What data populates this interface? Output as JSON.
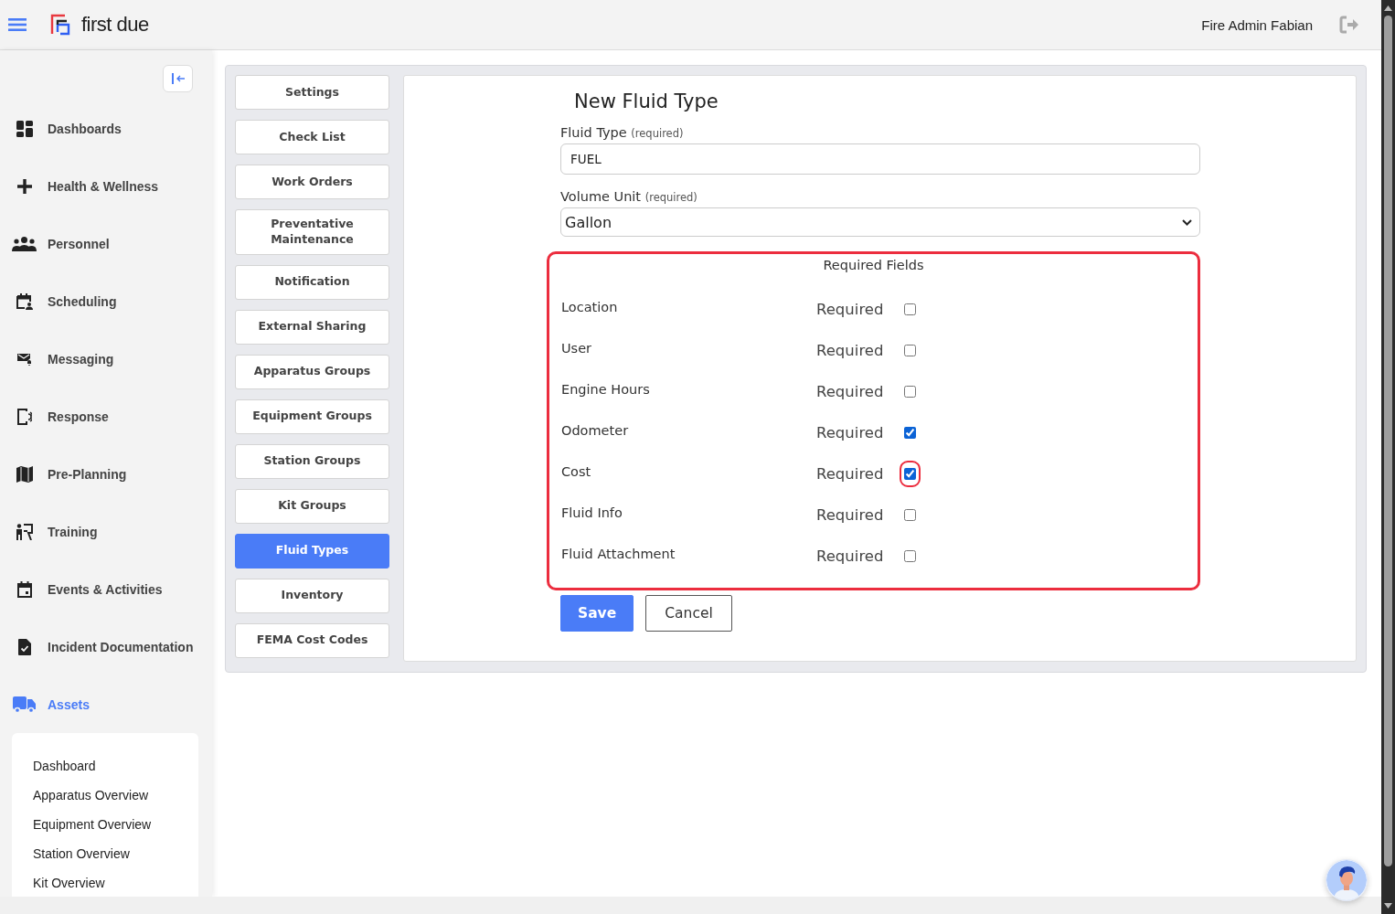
{
  "logo": {
    "text": "first due"
  },
  "header": {
    "user_name": "Fire Admin Fabian"
  },
  "sidebar": {
    "items": [
      {
        "label": "Dashboards",
        "selected": false
      },
      {
        "label": "Health & Wellness",
        "selected": false
      },
      {
        "label": "Personnel",
        "selected": false
      },
      {
        "label": "Scheduling",
        "selected": false
      },
      {
        "label": "Messaging",
        "selected": false
      },
      {
        "label": "Response",
        "selected": false
      },
      {
        "label": "Pre-Planning",
        "selected": false
      },
      {
        "label": "Training",
        "selected": false
      },
      {
        "label": "Events & Activities",
        "selected": false
      },
      {
        "label": "Incident Documentation",
        "selected": false
      },
      {
        "label": "Assets",
        "selected": true,
        "children": [
          {
            "label": "Dashboard"
          },
          {
            "label": "Apparatus Overview"
          },
          {
            "label": "Equipment Overview"
          },
          {
            "label": "Station Overview"
          },
          {
            "label": "Kit Overview"
          }
        ]
      }
    ]
  },
  "settings_menu": [
    {
      "label": "Settings",
      "selected": false
    },
    {
      "label": "Check List",
      "selected": false
    },
    {
      "label": "Work Orders",
      "selected": false
    },
    {
      "label": "Preventative Maintenance",
      "selected": false
    },
    {
      "label": "Notification",
      "selected": false
    },
    {
      "label": "External Sharing",
      "selected": false
    },
    {
      "label": "Apparatus Groups",
      "selected": false
    },
    {
      "label": "Equipment Groups",
      "selected": false
    },
    {
      "label": "Station Groups",
      "selected": false
    },
    {
      "label": "Kit Groups",
      "selected": false
    },
    {
      "label": "Fluid Types",
      "selected": true
    },
    {
      "label": "Inventory",
      "selected": false
    },
    {
      "label": "FEMA Cost Codes",
      "selected": false
    }
  ],
  "form": {
    "title": "New Fluid Type",
    "fields": [
      {
        "label": "Fluid Type",
        "note": "(required)",
        "kind": "text",
        "value": "FUEL"
      },
      {
        "label": "Volume Unit",
        "note": "(required)",
        "kind": "select",
        "value": "Gallon"
      }
    ],
    "required_fields": {
      "title": "Required Fields",
      "highlighted": true,
      "items": [
        {
          "label": "Location",
          "option": "Required",
          "checked": false,
          "highlighted": false
        },
        {
          "label": "User",
          "option": "Required",
          "checked": false,
          "highlighted": false
        },
        {
          "label": "Engine Hours",
          "option": "Required",
          "checked": false,
          "highlighted": false
        },
        {
          "label": "Odometer",
          "option": "Required",
          "checked": true,
          "highlighted": false
        },
        {
          "label": "Cost",
          "option": "Required",
          "checked": true,
          "highlighted": true
        },
        {
          "label": "Fluid Info",
          "option": "Required",
          "checked": false,
          "highlighted": false
        },
        {
          "label": "Fluid Attachment",
          "option": "Required",
          "checked": false,
          "highlighted": false
        }
      ]
    },
    "buttons": [
      {
        "label": "Save",
        "kind": "primary"
      },
      {
        "label": "Cancel",
        "kind": "secondary"
      }
    ]
  }
}
